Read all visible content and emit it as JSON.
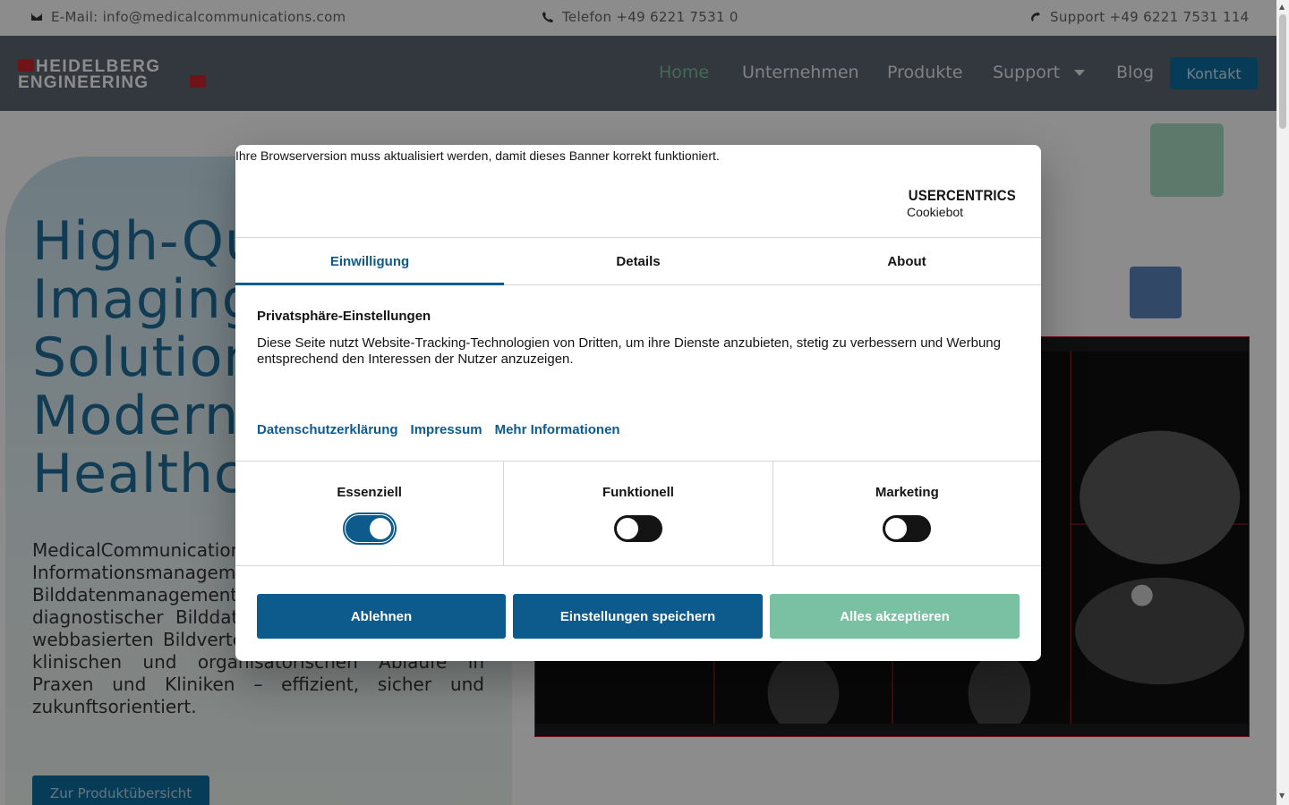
{
  "topbar": {
    "email": "E-Mail: info@medicalcommunications.com",
    "phone": "Telefon +49 6221 7531 0",
    "support": "Support +49 6221 7531 114"
  },
  "nav": {
    "logo_line1": "HEIDELBERG",
    "logo_line2": "ENGINEERING",
    "items": [
      "Home",
      "Unternehmen",
      "Produkte",
      "Support",
      "Blog"
    ],
    "contact": "Kontakt"
  },
  "hero": {
    "title_lines": [
      "High-Qu",
      "Imaging",
      "Solution",
      "Modern",
      "Healthc"
    ],
    "text": "MedicalCommunication Anbietern im Berei Informationsmanageme Mit leistungsstark Bilddatenmanagement, Archivierung diagnostischer Bilddaten sowie einer schnellen, webbasierten Bildverteilung unterstützen wir die klinischen und organisatorischen Abläufe in Praxen und Kliniken – effizient, sicher und zukunftsorientiert.",
    "button": "Zur Produktübersicht"
  },
  "dialog": {
    "notice": "Ihre Browserversion muss aktualisiert werden, damit dieses Banner korrekt funktioniert.",
    "brand_top": "USERCENTRICS",
    "brand_bottom": "Cookiebot",
    "tabs": [
      "Einwilligung",
      "Details",
      "About"
    ],
    "section_title": "Privatsphäre-Einstellungen",
    "section_text": "Diese Seite nutzt Website-Tracking-Technologien von Dritten, um ihre Dienste anzubieten, stetig zu verbessern und Werbung entsprechend den Interessen der Nutzer anzuzeigen.",
    "links": [
      "Datenschutzerklärung",
      "Impressum",
      "Mehr Informationen"
    ],
    "categories": [
      {
        "label": "Essenziell",
        "enabled": true
      },
      {
        "label": "Funktionell",
        "enabled": false
      },
      {
        "label": "Marketing",
        "enabled": false
      }
    ],
    "buttons": {
      "decline": "Ablehnen",
      "save": "Einstellungen speichern",
      "accept": "Alles akzeptieren"
    }
  },
  "colors": {
    "primary": "#0d5b8c",
    "accept": "#7ac0a2",
    "navbar": "#5c6771"
  }
}
